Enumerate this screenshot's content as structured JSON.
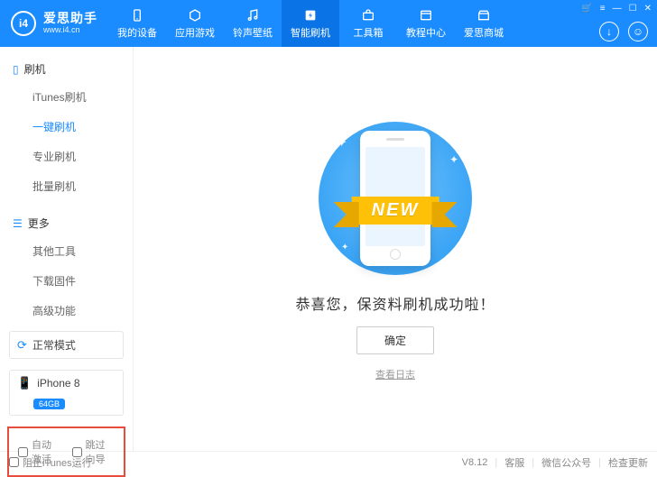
{
  "brand": {
    "name": "爱思助手",
    "url": "www.i4.cn",
    "badge": "i4"
  },
  "nav": [
    {
      "label": "我的设备",
      "icon": "phone"
    },
    {
      "label": "应用游戏",
      "icon": "apps"
    },
    {
      "label": "铃声壁纸",
      "icon": "music"
    },
    {
      "label": "智能刷机",
      "icon": "flash",
      "active": true
    },
    {
      "label": "工具箱",
      "icon": "toolbox"
    },
    {
      "label": "教程中心",
      "icon": "book"
    },
    {
      "label": "爱思商城",
      "icon": "store"
    }
  ],
  "sidebar": {
    "section1": {
      "title": "刷机",
      "items": [
        "iTunes刷机",
        "一键刷机",
        "专业刷机",
        "批量刷机"
      ],
      "activeIndex": 1
    },
    "section2": {
      "title": "更多",
      "items": [
        "其他工具",
        "下载固件",
        "高级功能"
      ]
    },
    "mode": "正常模式",
    "device": {
      "name": "iPhone 8",
      "capacity": "64GB"
    },
    "options": {
      "autoActivate": "自动激活",
      "skipGuide": "跳过向导"
    }
  },
  "main": {
    "ribbon": "NEW",
    "successText": "恭喜您，保资料刷机成功啦！",
    "okButton": "确定",
    "viewLog": "查看日志"
  },
  "footer": {
    "blockItunes": "阻止iTunes运行",
    "version": "V8.12",
    "support": "客服",
    "wechat": "微信公众号",
    "update": "检查更新"
  }
}
